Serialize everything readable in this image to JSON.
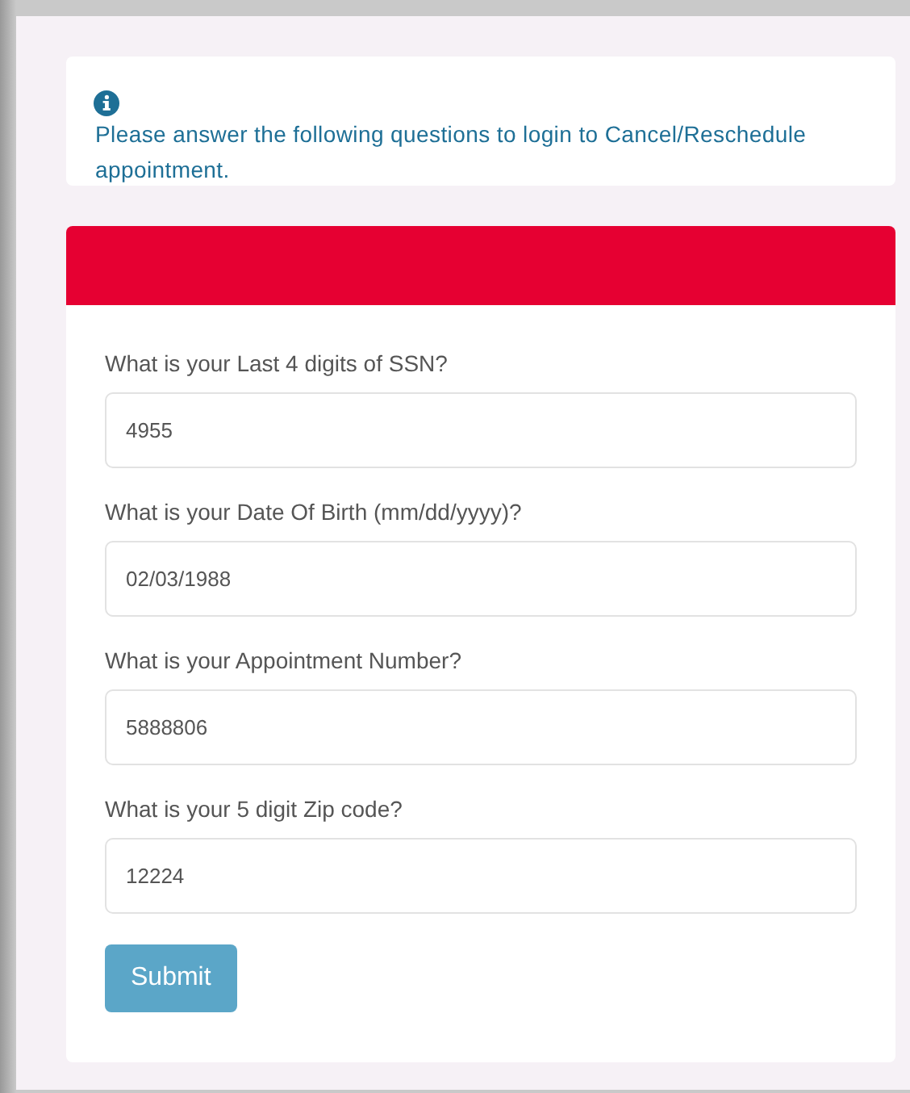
{
  "notice": {
    "text": "Please answer the following questions to login to Cancel/Reschedule appointment."
  },
  "form": {
    "questions": [
      {
        "label": "What is your Last 4 digits of SSN?",
        "value": "4955"
      },
      {
        "label": "What is your Date Of Birth (mm/dd/yyyy)?",
        "value": "02/03/1988"
      },
      {
        "label": "What is your Appointment Number?",
        "value": "5888806"
      },
      {
        "label": "What is your 5 digit Zip code?",
        "value": "12224"
      }
    ],
    "submit": "Submit"
  }
}
